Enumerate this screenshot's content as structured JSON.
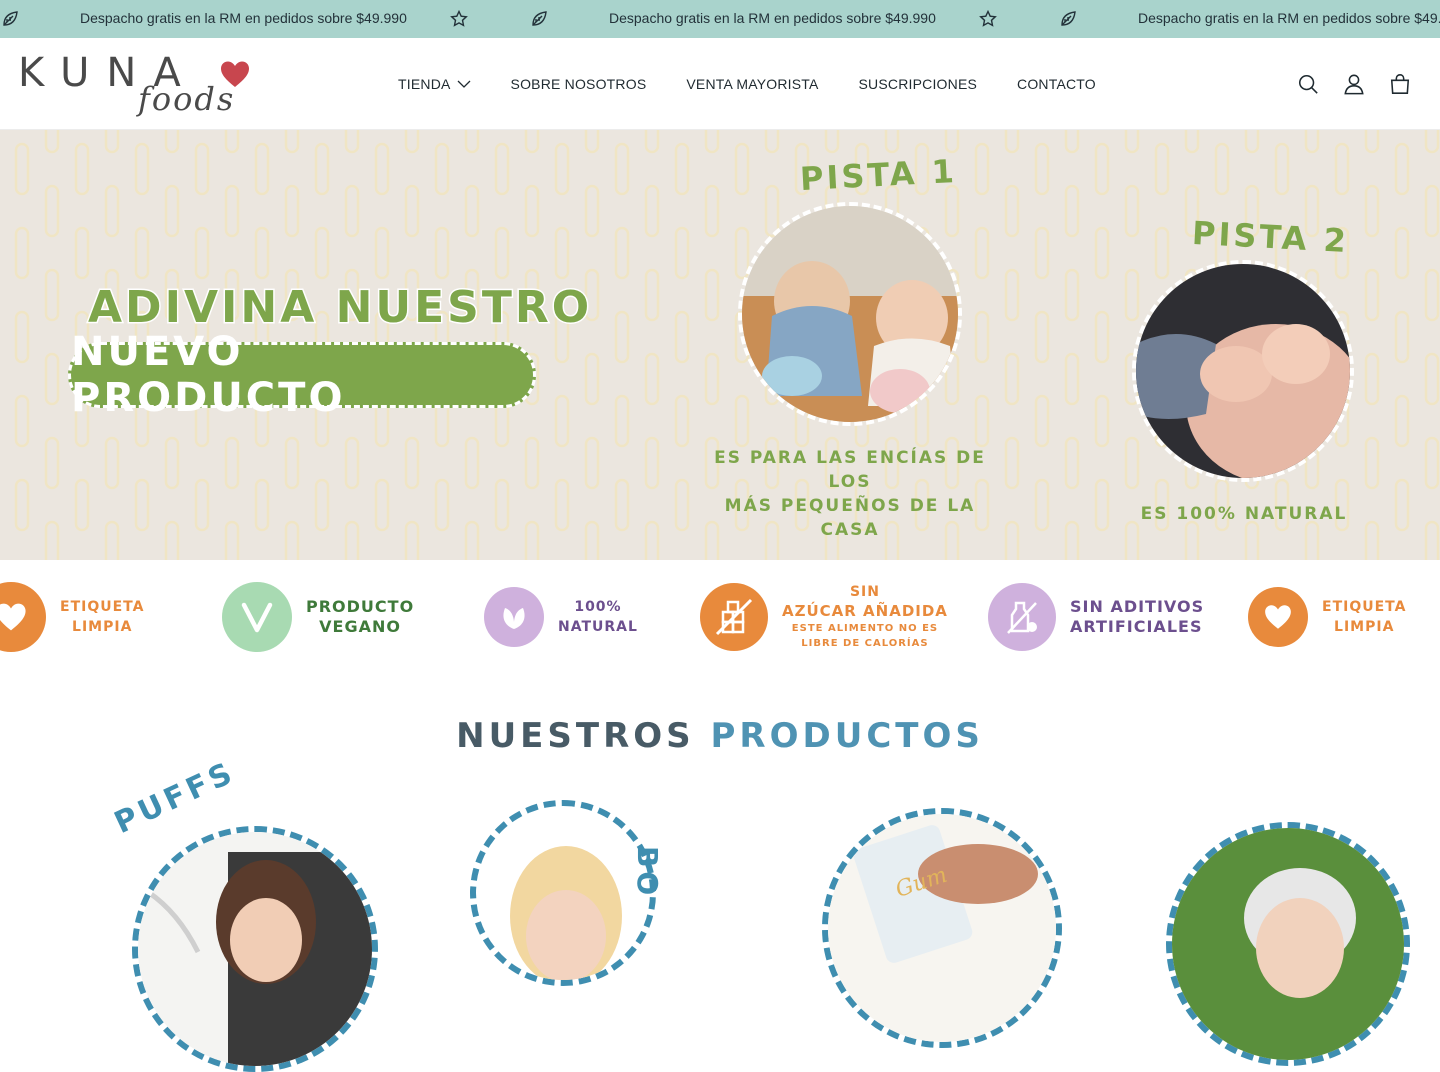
{
  "announcement": {
    "text": "Despacho gratis en la RM en pedidos sobre $49.990",
    "icons": [
      "leaf-icon",
      "star-icon"
    ]
  },
  "header": {
    "logo_main": "KUNA",
    "logo_sub": "foods",
    "nav": [
      {
        "label": "TIENDA",
        "has_dropdown": true
      },
      {
        "label": "SOBRE NOSOTROS"
      },
      {
        "label": "VENTA MAYORISTA"
      },
      {
        "label": "SUSCRIPCIONES"
      },
      {
        "label": "CONTACTO"
      }
    ],
    "icons": [
      "search-icon",
      "account-icon",
      "cart-icon"
    ]
  },
  "hero": {
    "title_line1": "ADIVINA NUESTRO",
    "title_line2": "NUEVO PRODUCTO",
    "clue1_title": "PISTA 1",
    "clue1_hint_line1": "ES PARA LAS ENCÍAS DE LOS",
    "clue1_hint_line2": "MÁS PEQUEÑOS DE LA CASA",
    "clue2_title": "PISTA 2",
    "clue2_hint": "ES 100% NATURAL",
    "colors": {
      "background": "#ebe6df",
      "green": "#7ea64b"
    }
  },
  "badges": [
    {
      "line1": "ETIQUETA",
      "line2": "LIMPIA",
      "color": "#e88a3c",
      "icon": "heart-icon"
    },
    {
      "line1": "PRODUCTO",
      "line2": "VEGANO",
      "color": "#3f7a3a",
      "circle_color": "#a8dab2",
      "icon": "vegan-v-icon"
    },
    {
      "line1": "100%",
      "line2": "NATURAL",
      "color": "#6c4f8e",
      "circle_color": "#cfb1dd",
      "icon": "leaf-icon"
    },
    {
      "line1": "SIN",
      "line2": "AZÚCAR AÑADIDA",
      "line3": "ESTE ALIMENTO NO ES",
      "line4": "LIBRE DE CALORÍAS",
      "color": "#e88a3c",
      "icon": "no-sugar-icon"
    },
    {
      "line1": "SIN ADITIVOS",
      "line2": "ARTIFICIALES",
      "color": "#6c4f8e",
      "circle_color": "#cfb1dd",
      "icon": "no-additives-icon"
    },
    {
      "line1": "ETIQUETA",
      "line2": "LIMPIA",
      "color": "#e88a3c",
      "icon": "heart-icon"
    }
  ],
  "products_section": {
    "title_word1": "NUESTROS",
    "title_word2": "PRODUCTOS",
    "products": [
      {
        "label": "PUFFS"
      },
      {
        "label": "BO"
      },
      {
        "label": ""
      },
      {
        "label": ""
      }
    ]
  }
}
